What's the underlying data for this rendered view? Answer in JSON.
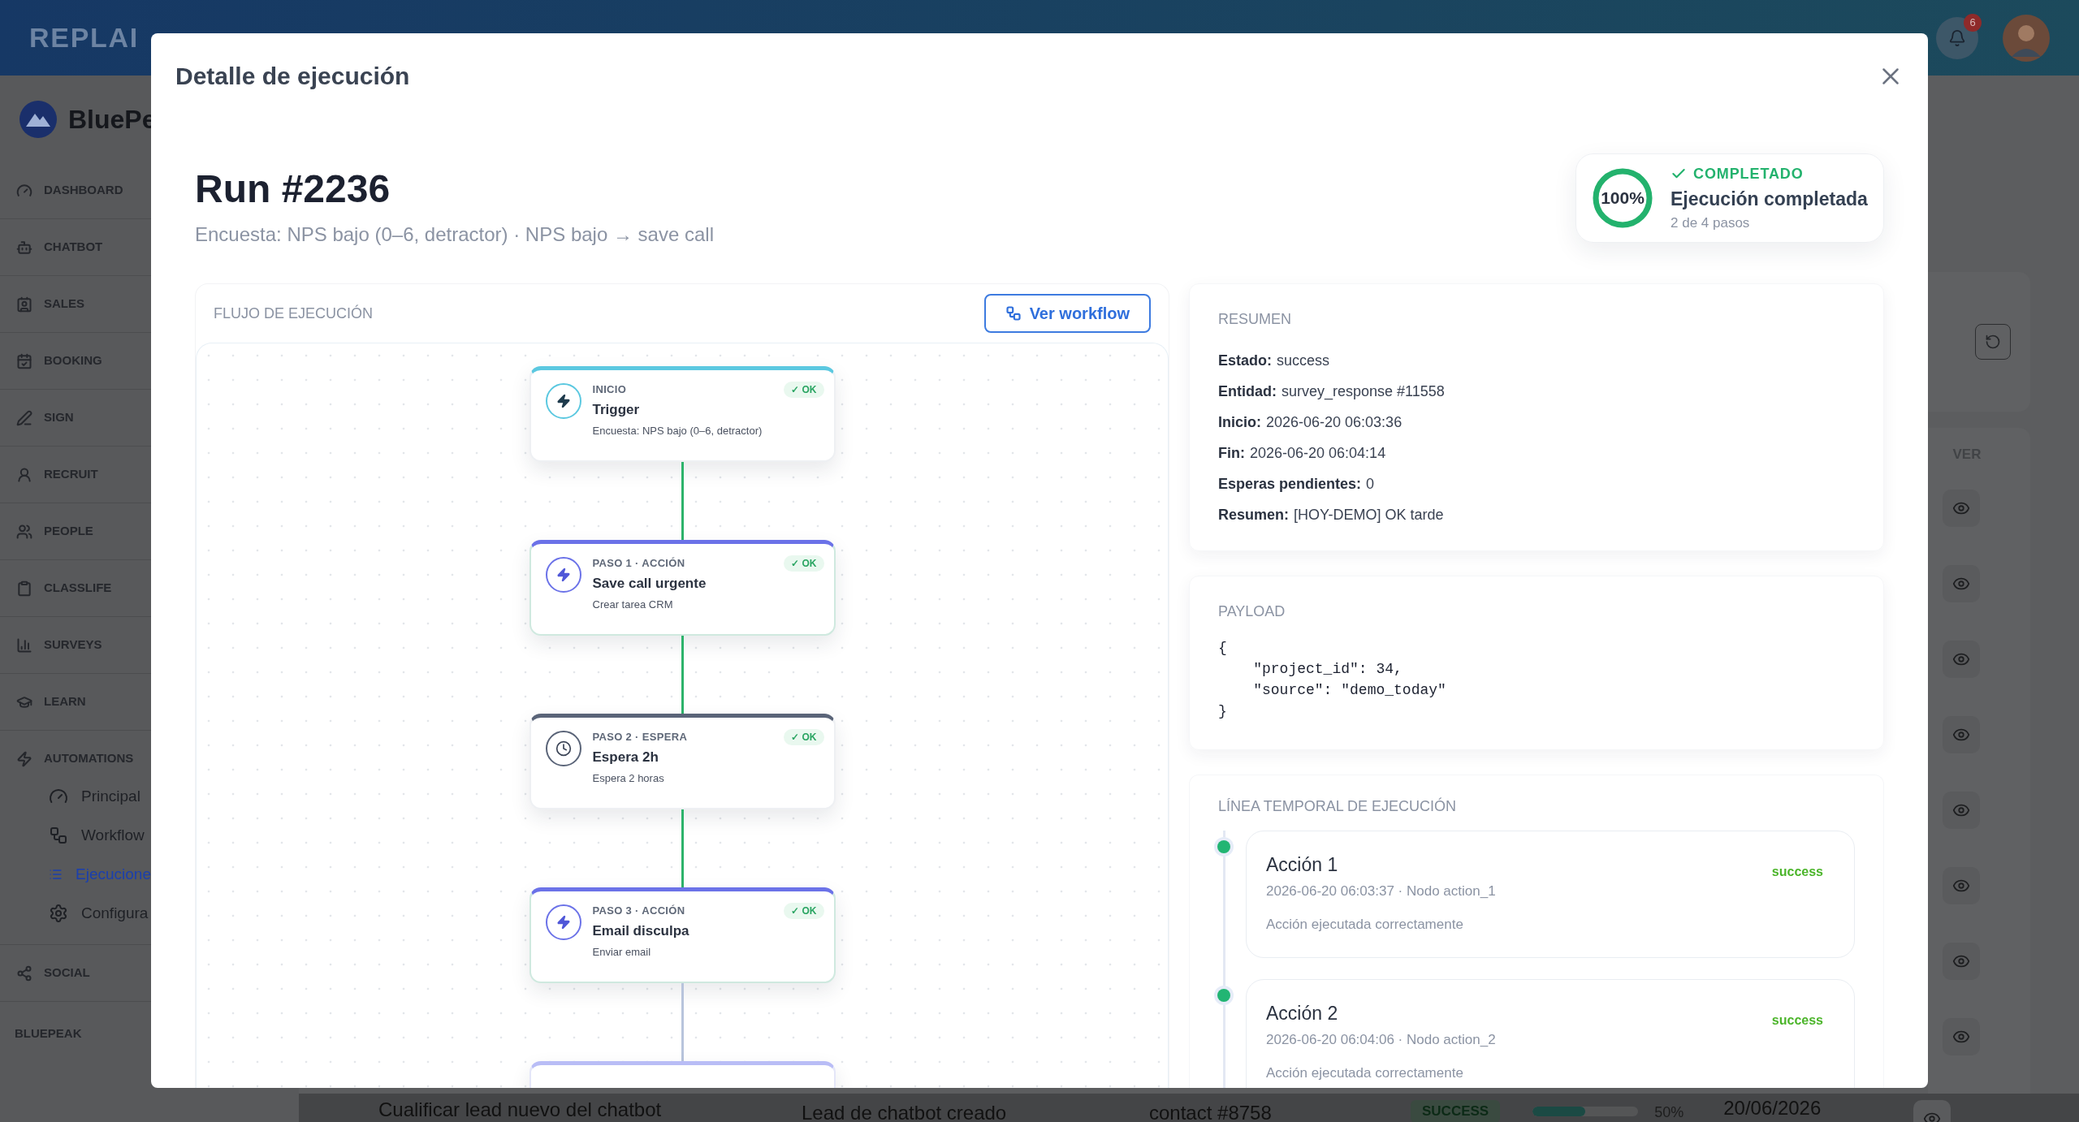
{
  "top_bar": {
    "logo": "REPLAI",
    "notification_count": "6"
  },
  "sidebar": {
    "brand": "BluePe",
    "items": [
      {
        "label": "DASHBOARD",
        "selected": false
      },
      {
        "label": "CHATBOT",
        "selected": false
      },
      {
        "label": "SALES",
        "selected": false
      },
      {
        "label": "BOOKING",
        "selected": false
      },
      {
        "label": "SIGN",
        "selected": false
      },
      {
        "label": "RECRUIT",
        "selected": false
      },
      {
        "label": "PEOPLE",
        "selected": false
      },
      {
        "label": "CLASSLIFE",
        "selected": false
      },
      {
        "label": "SURVEYS",
        "selected": false
      },
      {
        "label": "LEARN",
        "selected": false
      },
      {
        "label": "AUTOMATIONS",
        "selected": false,
        "children": [
          {
            "label": "Principal",
            "selected": false
          },
          {
            "label": "Workflow",
            "selected": false
          },
          {
            "label": "Ejecucione",
            "selected": true
          },
          {
            "label": "Configura",
            "selected": false
          }
        ]
      },
      {
        "label": "SOCIAL",
        "selected": false
      }
    ],
    "footer": "BLUEPEAK"
  },
  "background_table": {
    "column_header": "VER",
    "row": {
      "name": "Cualificar lead nuevo del chatbot",
      "event": "Lead de chatbot creado",
      "entity": "contact #8758",
      "status": "SUCCESS",
      "progress": {
        "level": 0.5,
        "reading": "50%"
      },
      "date": "20/06/2026"
    }
  },
  "modal": {
    "title": "Detalle de ejecución",
    "run_title": "Run #2236",
    "subtitle": "Encuesta: NPS bajo (0–6, detractor) · NPS bajo → save call",
    "status": {
      "percent": "100%",
      "level": 1,
      "label": "COMPLETADO",
      "title": "Ejecución completada",
      "steps": "2 de 4 pasos"
    },
    "flow": {
      "heading": "FLUJO DE EJECUCIÓN",
      "button": "Ver workflow",
      "nodes": [
        {
          "kind": "trigger",
          "reached": true,
          "label": "INICIO",
          "title": "Trigger",
          "detail": "Encuesta: NPS bajo (0–6, detractor)",
          "badge": "✓ OK"
        },
        {
          "kind": "action",
          "reached": true,
          "label": "PASO 1 · ACCIÓN",
          "title": "Save call urgente",
          "detail": "Crear tarea CRM",
          "badge": "✓ OK"
        },
        {
          "kind": "wait",
          "reached": true,
          "label": "PASO 2 · ESPERA",
          "title": "Espera 2h",
          "detail": "Espera 2 horas",
          "badge": "✓ OK"
        },
        {
          "kind": "action",
          "reached": true,
          "label": "PASO 3 · ACCIÓN",
          "title": "Email disculpa",
          "detail": "Enviar email",
          "badge": "✓ OK"
        },
        {
          "kind": "action",
          "reached": false
        }
      ]
    },
    "summary": {
      "heading": "RESUMEN",
      "fields": [
        {
          "label": "Estado:",
          "value": "success"
        },
        {
          "label": "Entidad:",
          "value": "survey_response #11558"
        },
        {
          "label": "Inicio:",
          "value": "2026-06-20 06:03:36"
        },
        {
          "label": "Fin:",
          "value": "2026-06-20 06:04:14"
        },
        {
          "label": "Esperas pendientes:",
          "value": "0"
        },
        {
          "label": "Resumen:",
          "value": "[HOY-DEMO] OK tarde"
        }
      ]
    },
    "payload": {
      "heading": "PAYLOAD",
      "code": "{\n    \"project_id\": 34,\n    \"source\": \"demo_today\"\n}"
    },
    "timeline": {
      "heading": "LÍNEA TEMPORAL DE EJECUCIÓN",
      "events": [
        {
          "title": "Acción 1",
          "meta": "2026-06-20 06:03:37 · Nodo action_1",
          "message": "Acción ejecutada correctamente",
          "status": "success"
        },
        {
          "title": "Acción 2",
          "meta": "2026-06-20 06:04:06 · Nodo action_2",
          "message": "Acción ejecutada correctamente",
          "status": "success"
        }
      ]
    }
  }
}
